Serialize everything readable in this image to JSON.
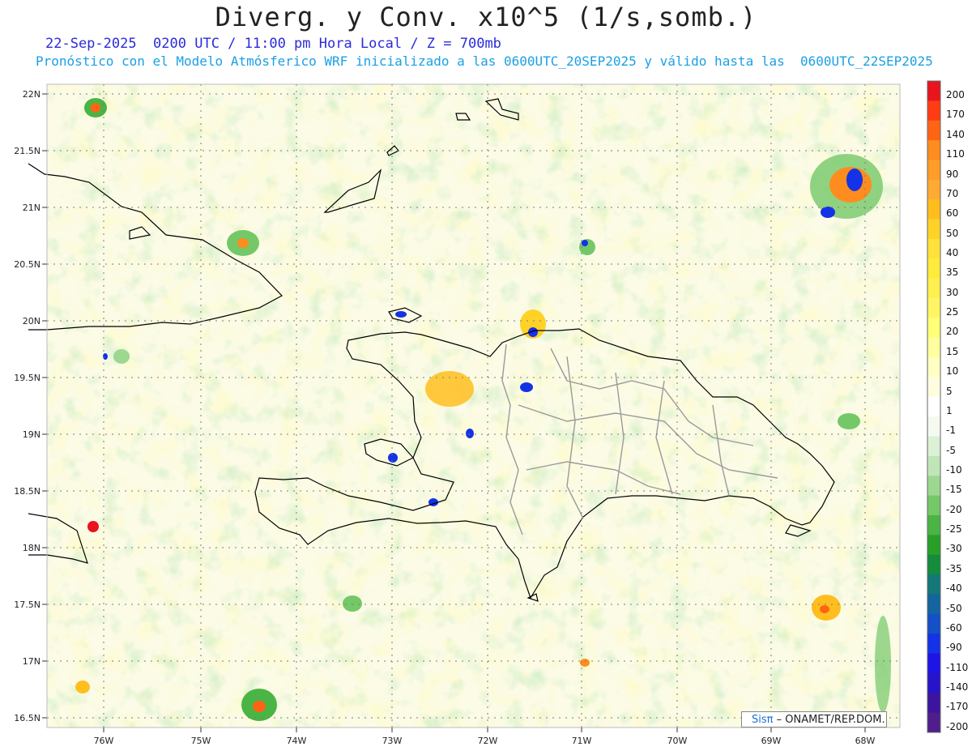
{
  "header": {
    "title": "Diverg. y Conv. x10^5 (1/s,somb.)",
    "valid_line": "22-Sep-2025  0200 UTC / 11:00 pm Hora Local / Z = 700mb",
    "model_line": "Pronóstico con el Modelo Atmósferico WRF inicializado a las 0600UTC_20SEP2025 y válido hasta las  0600UTC_22SEP2025"
  },
  "map": {
    "lat_labels": [
      "22N",
      "21.5N",
      "21N",
      "20.5N",
      "20N",
      "19.5N",
      "19N",
      "18.5N",
      "18N",
      "17.5N",
      "17N",
      "16.5N"
    ],
    "lon_labels": [
      "76W",
      "75W",
      "74W",
      "73W",
      "72W",
      "71W",
      "70W",
      "69W",
      "68W"
    ]
  },
  "colorbar": {
    "labels": [
      "200",
      "170",
      "140",
      "110",
      "90",
      "70",
      "60",
      "50",
      "40",
      "35",
      "30",
      "25",
      "20",
      "15",
      "10",
      "5",
      "1",
      "-1",
      "-5",
      "-10",
      "-15",
      "-20",
      "-25",
      "-30",
      "-35",
      "-40",
      "-50",
      "-60",
      "-90",
      "-110",
      "-140",
      "-170",
      "-200"
    ],
    "colors": [
      "#e8141e",
      "#ff3c14",
      "#ff6414",
      "#ff8c1e",
      "#ff9d28",
      "#ffaa32",
      "#ffbe1e",
      "#ffd228",
      "#ffe13c",
      "#ffeb3c",
      "#fff050",
      "#fff564",
      "#ffff78",
      "#ffffa0",
      "#ffffc4",
      "#fffde0",
      "#ffffff",
      "#f4faf0",
      "#dcf0d6",
      "#c0e6b8",
      "#9cd890",
      "#74c868",
      "#4ab444",
      "#28a028",
      "#148c3c",
      "#147878",
      "#1464a0",
      "#1450c8",
      "#1432e6",
      "#1e14e6",
      "#2814c8",
      "#3c14a0",
      "#501e8c"
    ]
  },
  "credit": {
    "brand": "Sis",
    "pi_symbol": "π",
    "text": "– ONAMET/REP.DOM."
  }
}
